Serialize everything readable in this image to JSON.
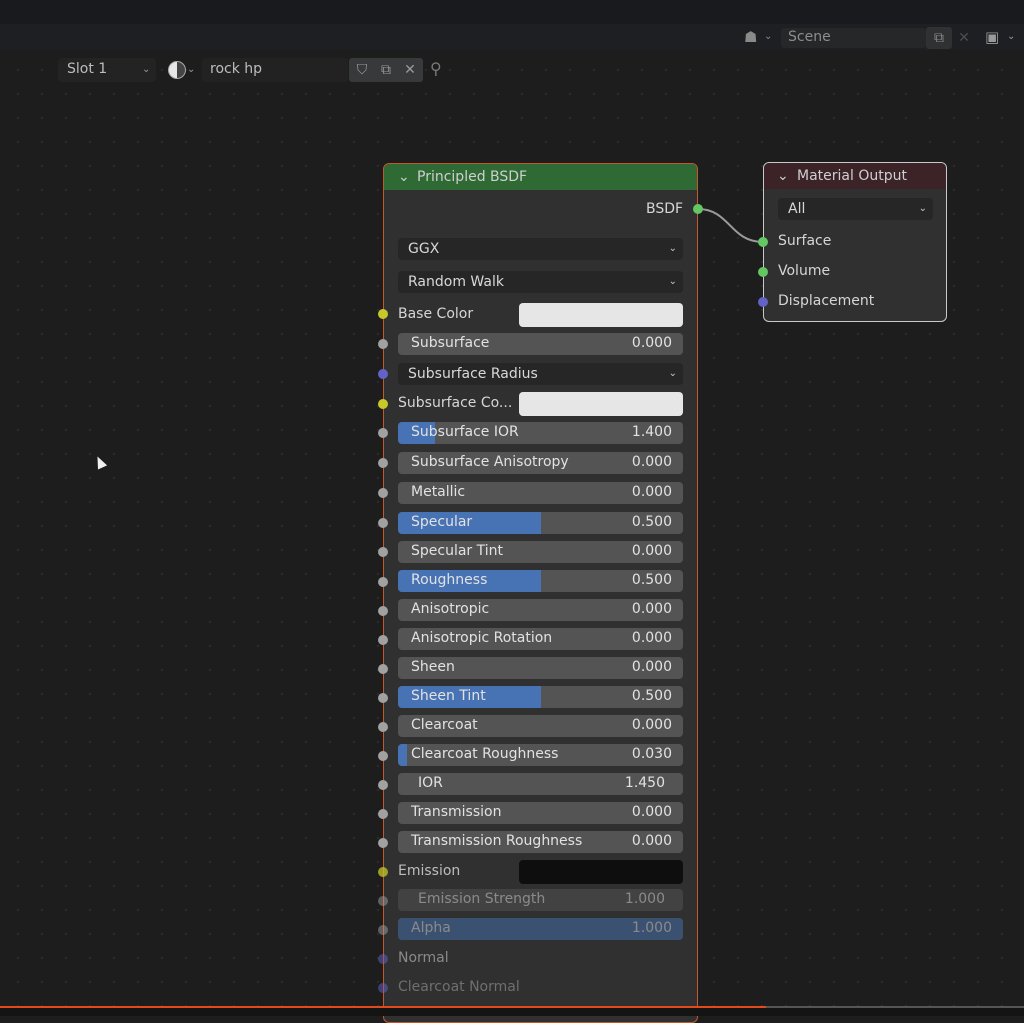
{
  "header": {
    "slot_label": "Slot 1",
    "material_name": "rock hp",
    "scene_label": "Scene"
  },
  "bsdf": {
    "title": "Principled BSDF",
    "output_label": "BSDF",
    "distribution": "GGX",
    "subsurface_method": "Random Walk",
    "base_color_label": "Base Color",
    "base_color": "#e6e6e6",
    "subsurface_radius_label": "Subsurface Radius",
    "subsurface_color_label": "Subsurface Co...",
    "subsurface_color": "#e6e6e6",
    "emission_label": "Emission",
    "emission_color": "#0e0e0e",
    "normal_label": "Normal",
    "clearcoat_normal_label": "Clearcoat Normal",
    "sliders": [
      {
        "label": "Subsurface",
        "value": "0.000",
        "fill": 0
      },
      {
        "label": "Subsurface IOR",
        "value": "1.400",
        "fill": 0.13
      },
      {
        "label": "Subsurface Anisotropy",
        "value": "0.000",
        "fill": 0
      },
      {
        "label": "Metallic",
        "value": "0.000",
        "fill": 0
      },
      {
        "label": "Specular",
        "value": "0.500",
        "fill": 0.5
      },
      {
        "label": "Specular Tint",
        "value": "0.000",
        "fill": 0
      },
      {
        "label": "Roughness",
        "value": "0.500",
        "fill": 0.5
      },
      {
        "label": "Anisotropic",
        "value": "0.000",
        "fill": 0
      },
      {
        "label": "Anisotropic Rotation",
        "value": "0.000",
        "fill": 0
      },
      {
        "label": "Sheen",
        "value": "0.000",
        "fill": 0
      },
      {
        "label": "Sheen Tint",
        "value": "0.500",
        "fill": 0.5
      },
      {
        "label": "Clearcoat",
        "value": "0.000",
        "fill": 0
      },
      {
        "label": "Clearcoat Roughness",
        "value": "0.030",
        "fill": 0.03
      },
      {
        "label": "IOR",
        "value": "1.450",
        "fill": 0
      },
      {
        "label": "Transmission",
        "value": "0.000",
        "fill": 0
      },
      {
        "label": "Transmission Roughness",
        "value": "0.000",
        "fill": 0
      }
    ],
    "emission_strength": {
      "label": "Emission Strength",
      "value": "1.000"
    },
    "alpha": {
      "label": "Alpha",
      "value": "1.000",
      "fill": 1
    }
  },
  "material_output": {
    "title": "Material Output",
    "target": "All",
    "surface_label": "Surface",
    "volume_label": "Volume",
    "displacement_label": "Displacement"
  }
}
